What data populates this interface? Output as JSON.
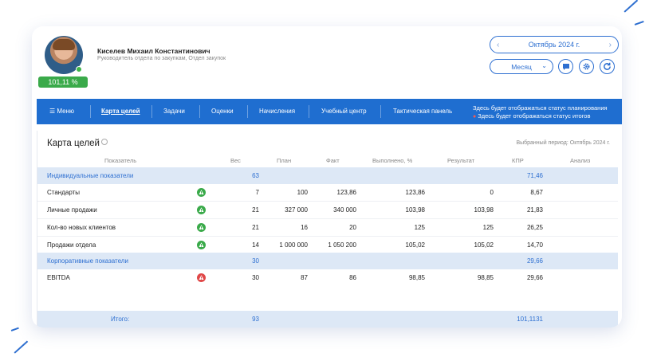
{
  "user": {
    "name": "Киселев Михаил Константинович",
    "role": "Руководитель отдела по закупкам, Отдел закупок",
    "score": "101,11 %"
  },
  "period": {
    "month_label": "Октябрь 2024 г.",
    "mode": "Месяц"
  },
  "nav": {
    "menu": "Меню",
    "items": [
      "Карта целей",
      "Задачи",
      "Оценки",
      "Начисления",
      "Учебный центр",
      "Тактическая панель"
    ],
    "status_planning": "Здесь будет отображаться статус планирования",
    "status_results": "Здесь будет отображаться статус итогов"
  },
  "panel": {
    "title": "Карта целей",
    "period_label": "Выбранный период: Октябрь 2024 г."
  },
  "table": {
    "headers": {
      "indicator": "Показатель",
      "weight": "Вес",
      "plan": "План",
      "fact": "Факт",
      "done": "Выполнено, %",
      "result": "Результат",
      "kpr": "КПР",
      "analysis": "Анализ"
    },
    "group_individual": {
      "label": "Индивидуальные показатели",
      "weight": "63",
      "kpr": "71,46"
    },
    "rows_individual": [
      {
        "name": "Стандарты",
        "status": "green",
        "weight": "7",
        "plan": "100",
        "fact": "123,86",
        "done": "123,86",
        "result": "0",
        "kpr": "8,67"
      },
      {
        "name": "Личные продажи",
        "status": "green",
        "weight": "21",
        "plan": "327 000",
        "fact": "340 000",
        "done": "103,98",
        "result": "103,98",
        "kpr": "21,83"
      },
      {
        "name": "Кол-во новых клиентов",
        "status": "green",
        "weight": "21",
        "plan": "16",
        "fact": "20",
        "done": "125",
        "result": "125",
        "kpr": "26,25"
      },
      {
        "name": "Продажи отдела",
        "status": "green",
        "weight": "14",
        "plan": "1 000 000",
        "fact": "1 050 200",
        "done": "105,02",
        "result": "105,02",
        "kpr": "14,70"
      }
    ],
    "group_corporate": {
      "label": "Корпоративные показатели",
      "weight": "30",
      "kpr": "29,66"
    },
    "rows_corporate": [
      {
        "name": "EBITDA",
        "status": "red",
        "weight": "30",
        "plan": "87",
        "fact": "86",
        "done": "98,85",
        "result": "98,85",
        "kpr": "29,66"
      }
    ],
    "total": {
      "label": "Итого:",
      "weight": "93",
      "kpr": "101,1131"
    }
  },
  "colors": {
    "accent": "#1f6ed0",
    "ok": "#3aaa4a",
    "warning": "#e04848"
  }
}
